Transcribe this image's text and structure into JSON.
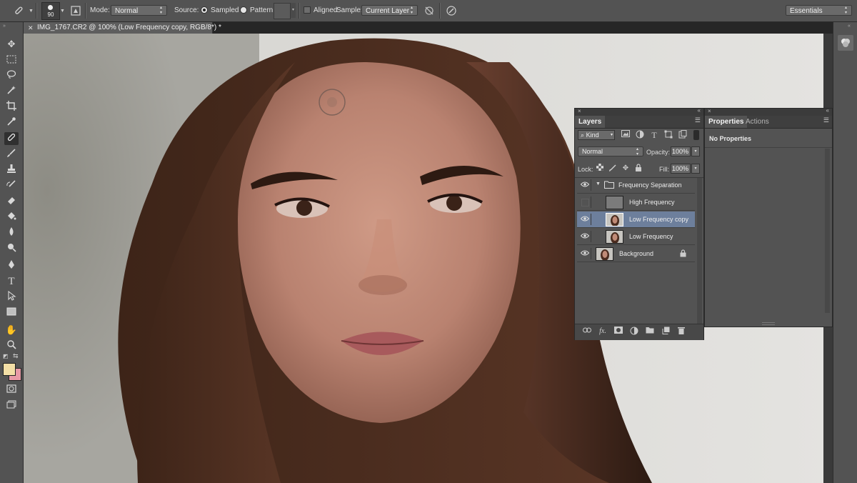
{
  "options_bar": {
    "brush_size": "90",
    "mode_label": "Mode:",
    "mode_value": "Normal",
    "source_label": "Source:",
    "sampled_label": "Sampled",
    "pattern_label": "Pattern:",
    "aligned_label": "Aligned",
    "sample_label": "Sample:",
    "sample_value": "Current Layer",
    "workspace_value": "Essentials"
  },
  "document": {
    "tab_title": "IMG_1767.CR2 @ 100% (Low Frequency copy, RGB/8*) *"
  },
  "toolbox": {
    "tools": [
      "move-tool",
      "marquee-tool",
      "lasso-tool",
      "magic-wand-tool",
      "crop-tool",
      "eyedropper-tool",
      "healing-brush-tool",
      "brush-tool",
      "clone-stamp-tool",
      "history-brush-tool",
      "eraser-tool",
      "paint-bucket-tool",
      "blur-tool",
      "dodge-tool",
      "pen-tool",
      "type-tool",
      "path-selection-tool",
      "rectangle-tool",
      "hand-tool",
      "zoom-tool"
    ],
    "foreground_color": "#f3dfa6",
    "background_color": "#e89aa6"
  },
  "layers_panel": {
    "tab_layers": "Layers",
    "filter_kind": "Kind",
    "blend_mode": "Normal",
    "opacity_label": "Opacity:",
    "opacity_value": "100%",
    "lock_label": "Lock:",
    "fill_label": "Fill:",
    "fill_value": "100%",
    "layers": [
      {
        "name": "Frequency Separation",
        "visible": true,
        "type": "group"
      },
      {
        "name": "High Frequency",
        "visible": false,
        "type": "gray"
      },
      {
        "name": "Low Frequency copy",
        "visible": true,
        "type": "photo",
        "selected": true
      },
      {
        "name": "Low Frequency",
        "visible": true,
        "type": "photo"
      },
      {
        "name": "Background",
        "visible": true,
        "type": "photo",
        "locked": true
      }
    ]
  },
  "properties_panel": {
    "tab_properties": "Properties",
    "tab_actions": "Actions",
    "content": "No Properties"
  }
}
